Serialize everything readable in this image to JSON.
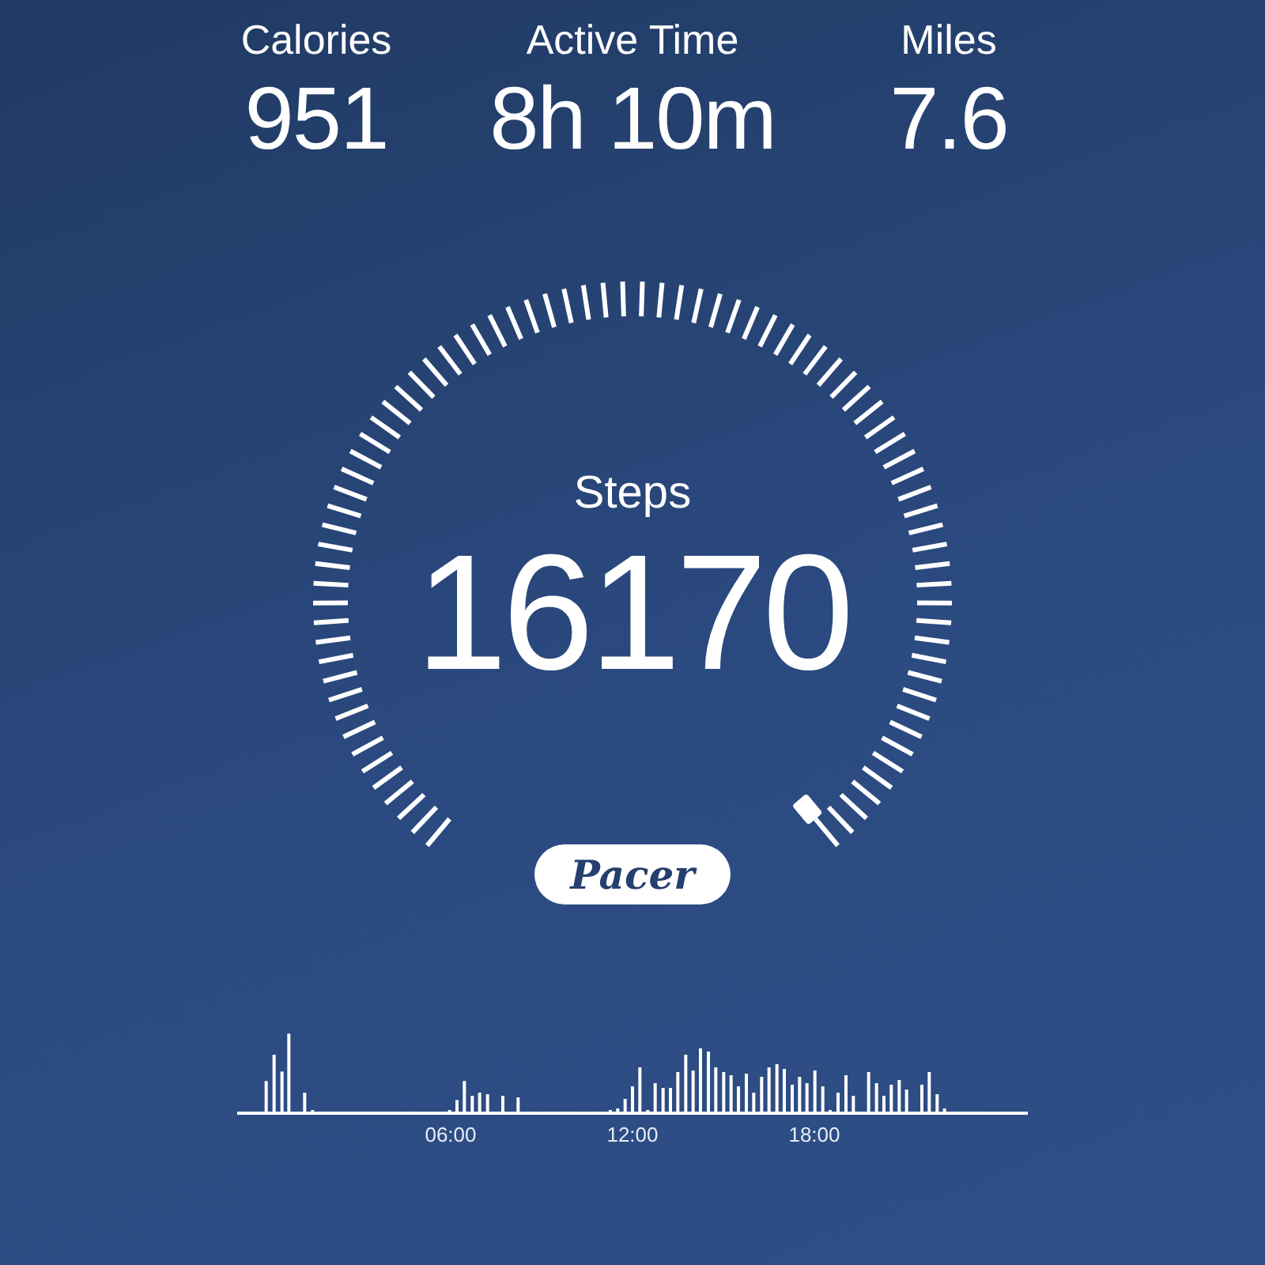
{
  "stats": [
    {
      "label": "Calories",
      "value": "951"
    },
    {
      "label": "Active Time",
      "value": "8h 10m"
    },
    {
      "label": "Miles",
      "value": "7.6"
    }
  ],
  "gauge": {
    "label": "Steps",
    "value": "16170"
  },
  "logo": {
    "text": "Pacer"
  },
  "activity_chart": {
    "kind": "picture",
    "x_labels": [
      "06:00",
      "12:00",
      "18:00"
    ]
  }
}
